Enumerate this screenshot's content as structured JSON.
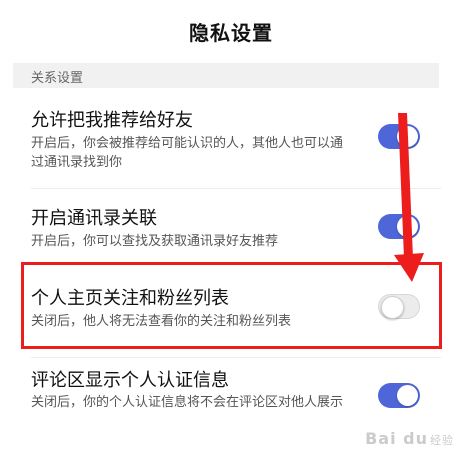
{
  "header": {
    "title": "隐私设置"
  },
  "section": {
    "label": "关系设置"
  },
  "settings": [
    {
      "title": "允许把我推荐给好友",
      "description": "开启后，你会被推荐给可能认识的人，其他人也可以通过通讯录找到你",
      "enabled": true
    },
    {
      "title": "开启通讯录关联",
      "description": "开启后，你可以查找及获取通讯录好友推荐",
      "enabled": true
    },
    {
      "title": "个人主页关注和粉丝列表",
      "description": "关闭后，他人将无法查看你的关注和粉丝列表",
      "enabled": false
    },
    {
      "title": "评论区显示个人认证信息",
      "description": "关闭后，你的个人认证信息将不会在评论区对他人展示",
      "enabled": true
    }
  ],
  "watermark": {
    "brand": "Bai du",
    "sub": "经验"
  },
  "colors": {
    "toggle_on": "#4f66d8",
    "toggle_off": "#ececec",
    "annotation_red": "#ee1d1d",
    "section_bg": "#f1f1f1"
  }
}
